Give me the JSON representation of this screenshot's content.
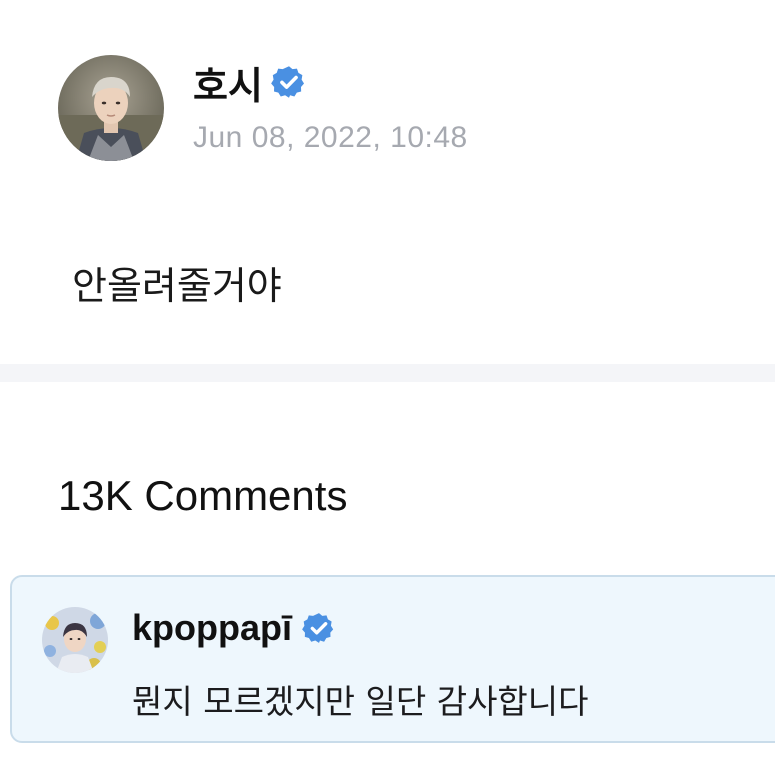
{
  "post": {
    "author": "호시",
    "timestamp": "Jun 08, 2022, 10:48",
    "body": "안올려줄거야"
  },
  "comments_section": {
    "count_label": "13K Comments"
  },
  "comment": {
    "author": "kpoppapī",
    "text": "뭔지 모르겠지만 일단 감사합니다"
  },
  "icons": {
    "verified": "verified-badge-icon"
  },
  "colors": {
    "verified_blue": "#4a90e2",
    "timestamp_gray": "#a6a9b0",
    "comment_bg": "#eef7fd",
    "divider_band": "#f4f5f8"
  }
}
